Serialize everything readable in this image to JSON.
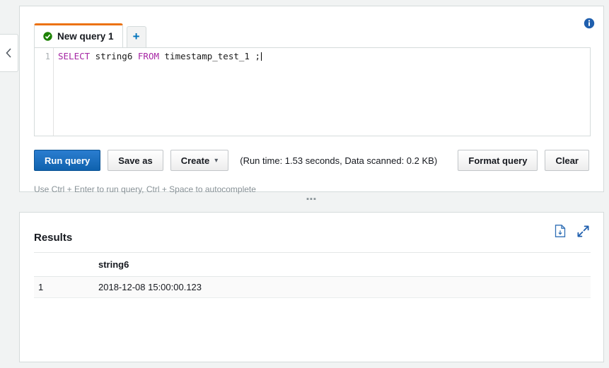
{
  "left_rail": {
    "collapse_icon": "chevron-left-icon"
  },
  "query_panel": {
    "info_icon": "info-circle-icon",
    "tabs": [
      {
        "label": "New query 1",
        "status_icon": "check-circle-icon",
        "active": true
      }
    ],
    "add_tab_label": "+",
    "editor": {
      "line_number": "1",
      "code_tokens": [
        {
          "text": "SELECT",
          "type": "keyword"
        },
        {
          "text": " string6 ",
          "type": "identifier"
        },
        {
          "text": "FROM",
          "type": "keyword"
        },
        {
          "text": " timestamp_test_1 ;",
          "type": "identifier"
        }
      ],
      "code_plain": "SELECT string6 FROM timestamp_test_1 ;",
      "code_select": "SELECT",
      "code_column": " string6 ",
      "code_from": "FROM",
      "code_table": " timestamp_test_1 ;"
    },
    "buttons": {
      "run_query": "Run query",
      "save_as": "Save as",
      "create": "Create",
      "create_caret": "⌄",
      "format_query": "Format query",
      "clear": "Clear"
    },
    "run_stats": "(Run time: 1.53 seconds, Data scanned: 0.2 KB)",
    "hint": "Use Ctrl + Enter to run query, Ctrl + Space to autocomplete"
  },
  "splitter": {
    "handle_dots": "▪▪▪"
  },
  "results_panel": {
    "title": "Results",
    "download_icon": "download-file-icon",
    "expand_icon": "expand-diagonal-icon",
    "columns": [
      "",
      "string6"
    ],
    "rows": [
      {
        "index": "1",
        "string6": "2018-12-08 15:00:00.123"
      }
    ]
  },
  "colors": {
    "page_background": "#f1f3f3",
    "panel_background": "#ffffff",
    "panel_border": "#d5dbdb",
    "tab_active_top": "#ec7211",
    "primary_button": "#0f62ae",
    "link_blue": "#0073bb",
    "status_green": "#1d8102",
    "keyword_purple": "#a626a4"
  }
}
